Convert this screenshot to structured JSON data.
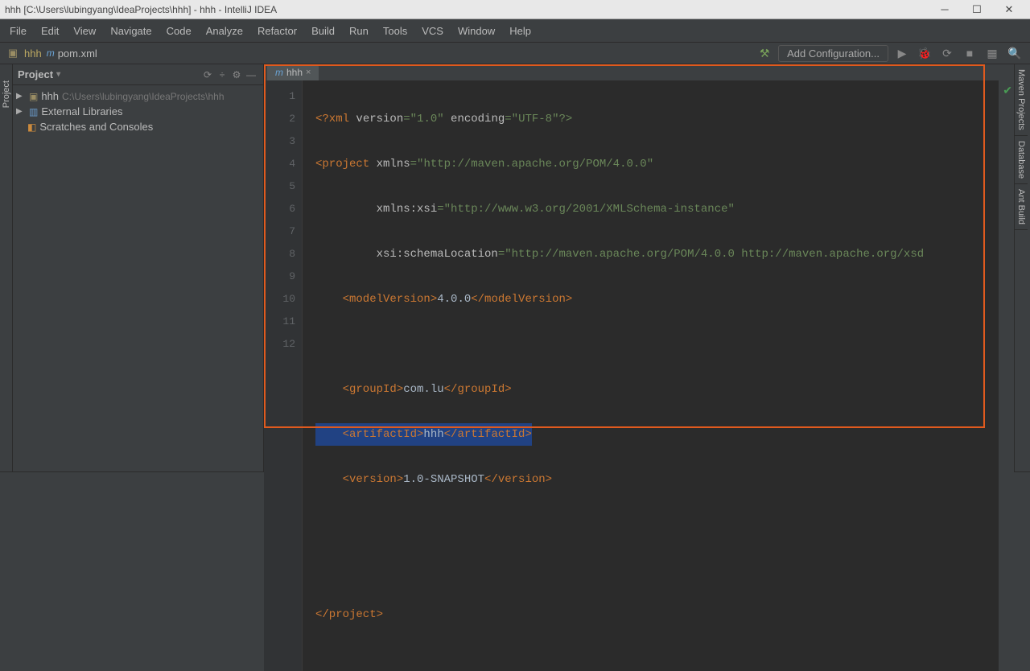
{
  "titlebar": "hhh [C:\\Users\\lubingyang\\IdeaProjects\\hhh] - hhh - IntelliJ IDEA",
  "menu": [
    "File",
    "Edit",
    "View",
    "Navigate",
    "Code",
    "Analyze",
    "Refactor",
    "Build",
    "Run",
    "Tools",
    "VCS",
    "Window",
    "Help"
  ],
  "breadcrumb": {
    "project": "hhh",
    "file": "pom.xml"
  },
  "config_button": "Add Configuration...",
  "sidebar": {
    "title": "Project",
    "tree": {
      "project_name": "hhh",
      "project_path": "C:\\Users\\lubingyang\\IdeaProjects\\hhh",
      "external_libs": "External Libraries",
      "scratches": "Scratches and Consoles"
    }
  },
  "tab": {
    "name": "hhh"
  },
  "right_tabs": [
    "Maven Projects",
    "Database",
    "Ant Build"
  ],
  "code": {
    "l1_a": "<?xml ",
    "l1_b": "version",
    "l1_c": "=\"1.0\" ",
    "l1_d": "encoding",
    "l1_e": "=\"UTF-8\"?>",
    "l2_a": "<project ",
    "l2_b": "xmlns",
    "l2_c": "=\"http://maven.apache.org/POM/4.0.0\"",
    "l3_a": "         xmlns:xsi",
    "l3_b": "=\"http://www.w3.org/2001/XMLSchema-instance\"",
    "l4_a": "         xsi:schemaLocation",
    "l4_b": "=\"http://maven.apache.org/POM/4.0.0 http://maven.apache.org/xsd",
    "l5_a": "    <modelVersion>",
    "l5_b": "4.0.0",
    "l5_c": "</modelVersion>",
    "l7_a": "    <groupId>",
    "l7_b": "com.lu",
    "l7_c": "</groupId>",
    "l8_a": "    <artifactId>",
    "l8_b": "hhh",
    "l8_c": "</artifactId>",
    "l9_a": "    <version>",
    "l9_b": "1.0-SNAPSHOT",
    "l9_c": "</version>",
    "l12": "</project>"
  },
  "line_numbers": [
    "1",
    "2",
    "3",
    "4",
    "5",
    "6",
    "7",
    "8",
    "9",
    "10",
    "11",
    "12"
  ]
}
